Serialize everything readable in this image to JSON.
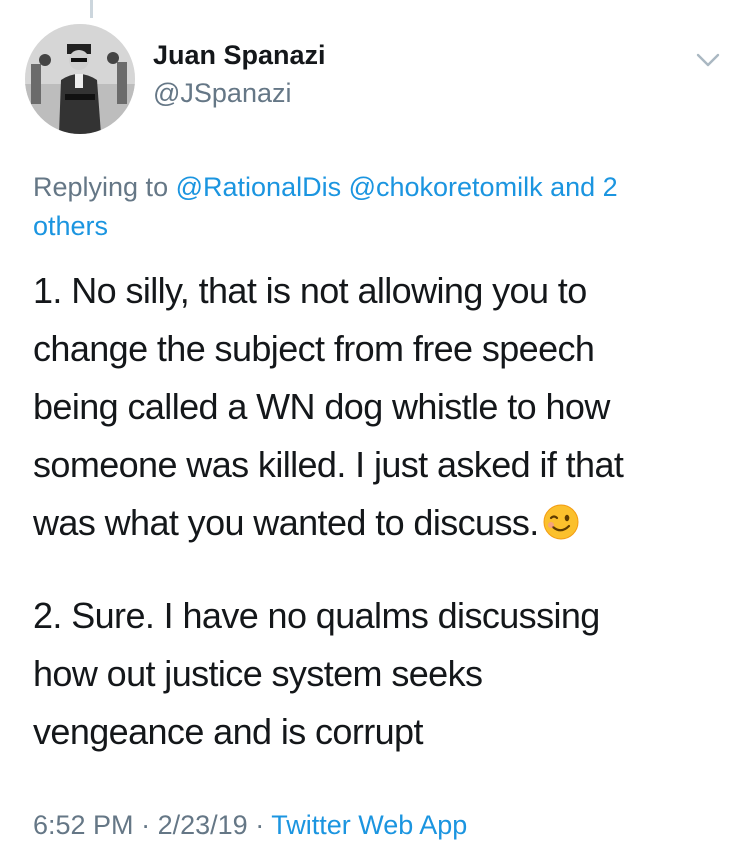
{
  "author": {
    "name": "Juan Spanazi",
    "handle": "@JSpanazi",
    "avatar_icon": "avatar-photo"
  },
  "reply": {
    "prefix": "Replying to",
    "mention1": "@RationalDis",
    "mention2": "@chokoretomilk",
    "and_others_line1": "and 2",
    "and_others_line2": "others"
  },
  "body": {
    "p1": [
      "1. No silly, that is not allowing you to",
      "change the subject from free speech",
      "being called a WN dog whistle to how",
      "someone was killed. I just asked if that",
      "was what you wanted to discuss."
    ],
    "p1_emoji": "winking-face-emoji",
    "p2": [
      "2. Sure. I have no qualms discussing",
      "how out justice system seeks",
      "vengeance and is corrupt"
    ]
  },
  "meta": {
    "time": "6:52 PM",
    "sep": "·",
    "date": "2/23/19",
    "app": "Twitter Web App"
  },
  "colors": {
    "link": "#1b95e0",
    "secondary": "#657786",
    "text": "#14171a"
  }
}
